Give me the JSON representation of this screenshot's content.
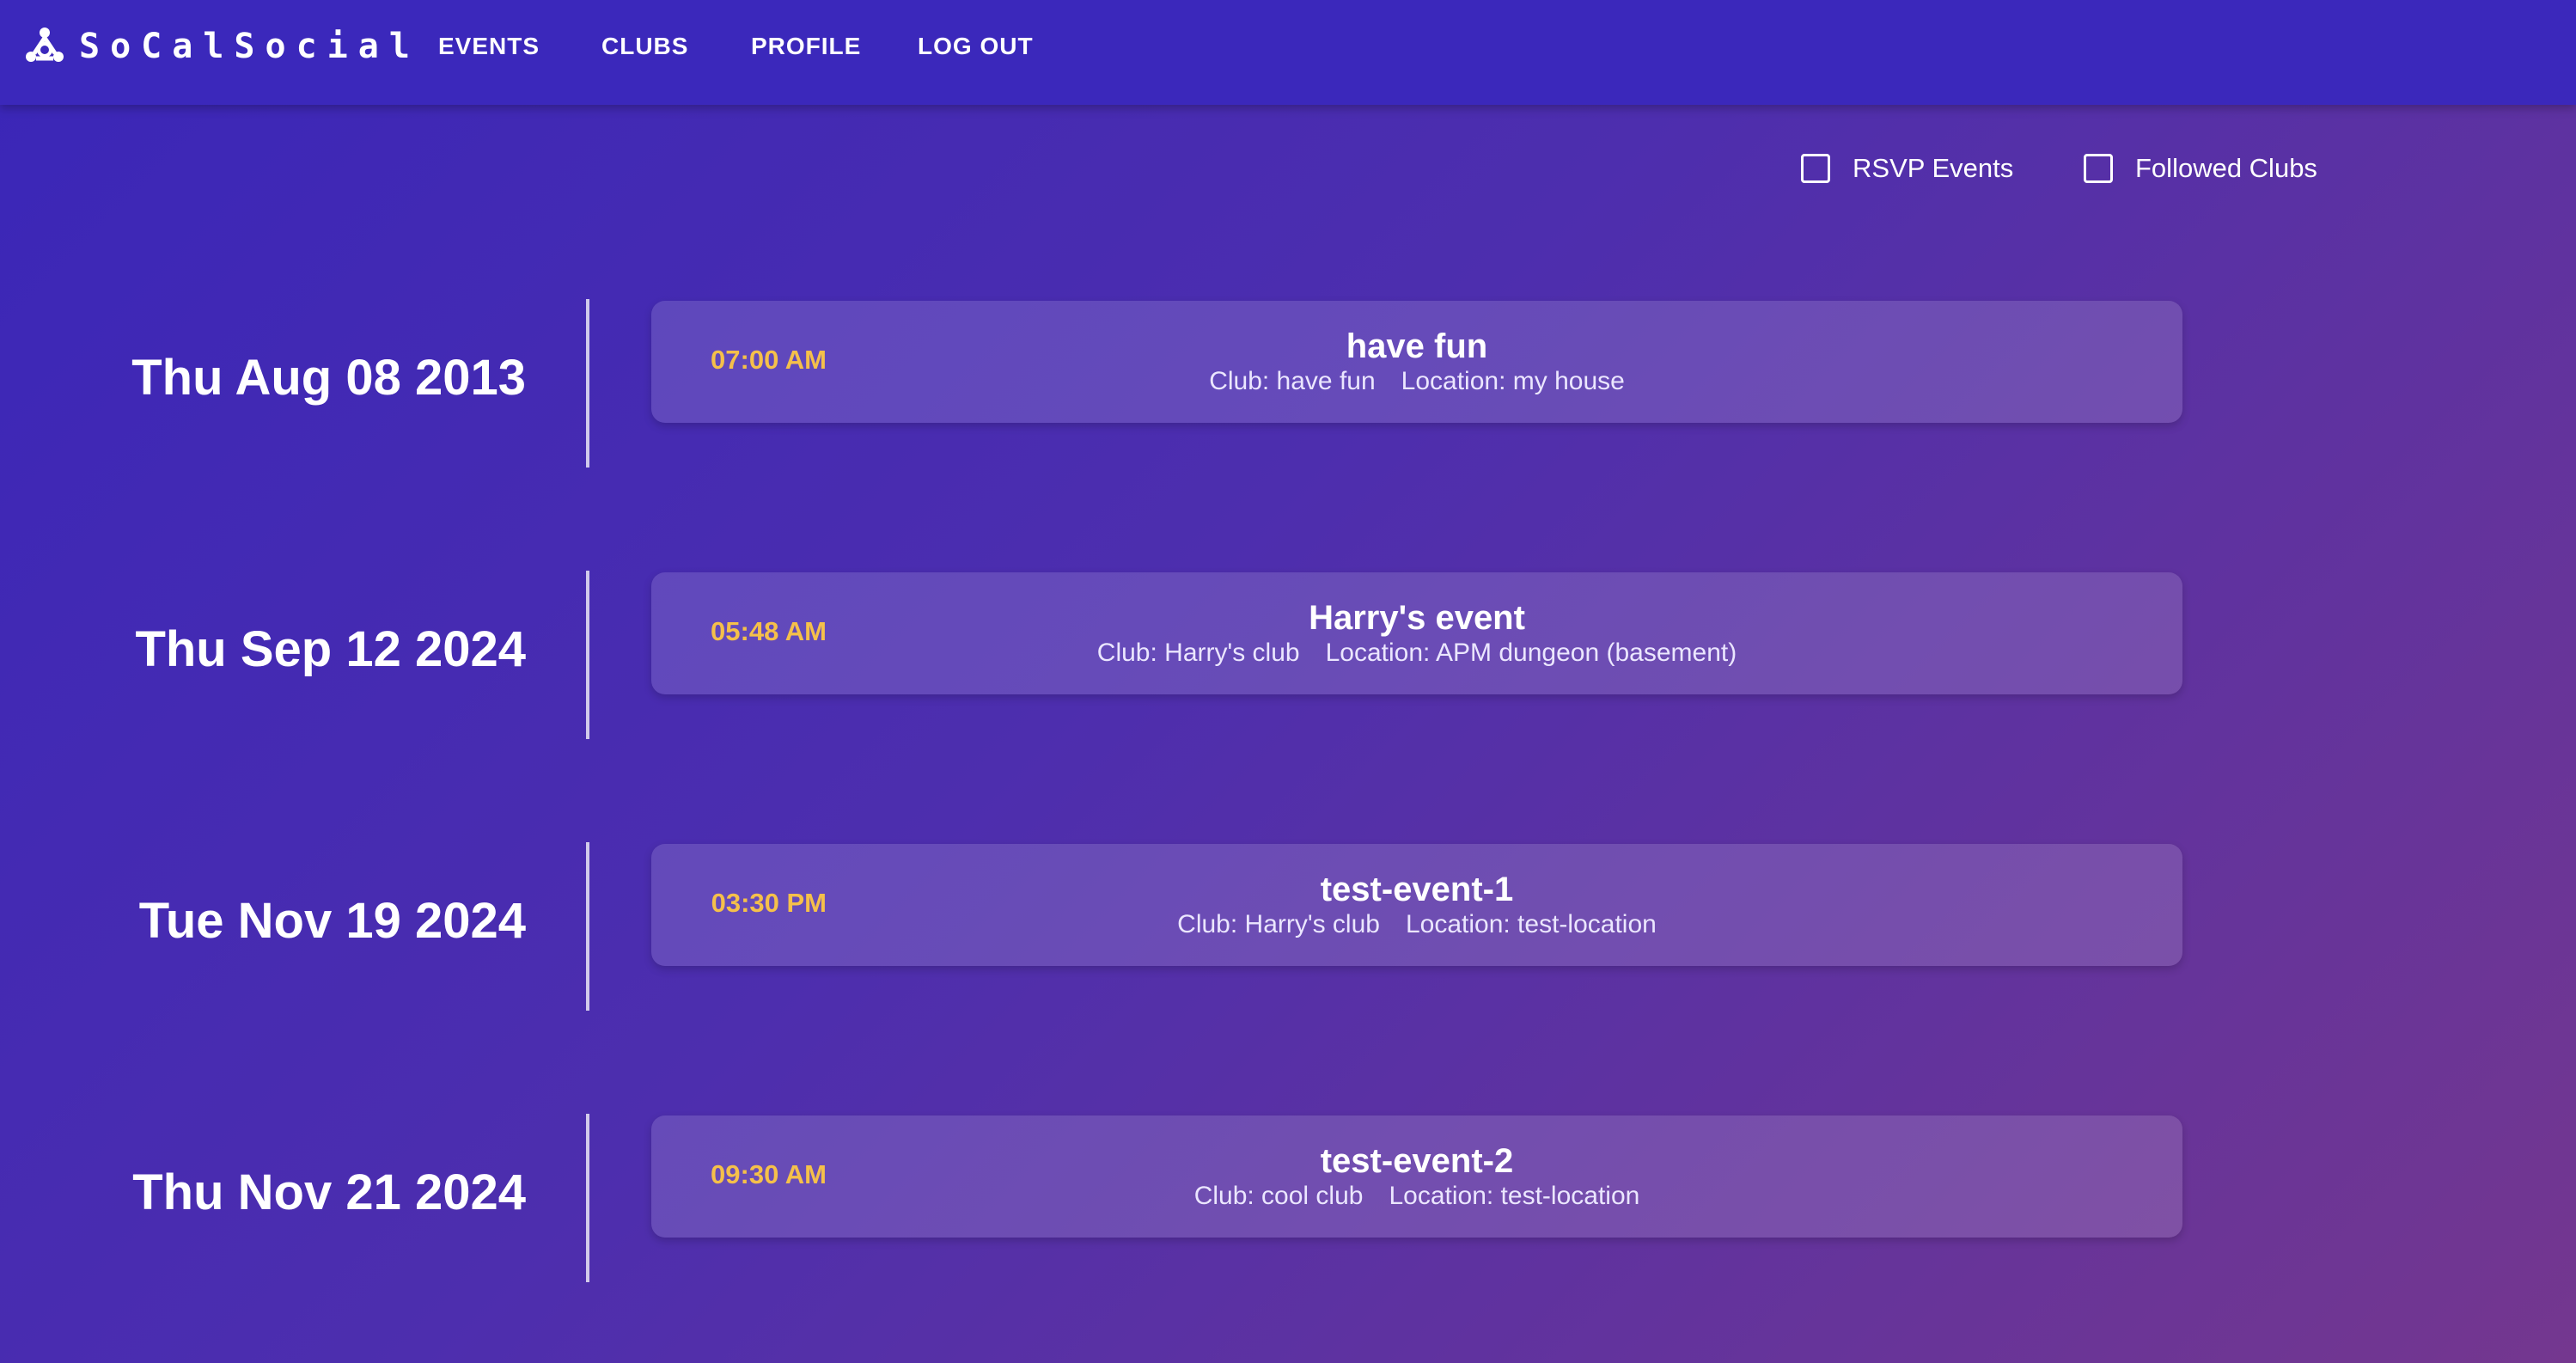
{
  "app": {
    "brand": "SoCalSocial",
    "logo_icon": "people-network-icon",
    "accent_color": "#3b28bb",
    "time_color": "#f5c04a"
  },
  "nav": {
    "events": "EVENTS",
    "clubs": "CLUBS",
    "profile": "PROFILE",
    "logout": "LOG OUT"
  },
  "filters": {
    "rsvp": {
      "label": "RSVP Events",
      "checked": false
    },
    "followed": {
      "label": "Followed Clubs",
      "checked": false
    }
  },
  "events": [
    {
      "date": "Thu Aug 08 2013",
      "time": "07:00 AM",
      "title": "have fun",
      "club": "Club: have fun",
      "location": "Location: my house"
    },
    {
      "date": "Thu Sep 12 2024",
      "time": "05:48 AM",
      "title": "Harry's event",
      "club": "Club: Harry's club",
      "location": "Location: APM dungeon (basement)"
    },
    {
      "date": "Tue Nov 19 2024",
      "time": "03:30 PM",
      "title": "test-event-1",
      "club": "Club: Harry's club",
      "location": "Location: test-location"
    },
    {
      "date": "Thu Nov 21 2024",
      "time": "09:30 AM",
      "title": "test-event-2",
      "club": "Club: cool club",
      "location": "Location: test-location"
    }
  ]
}
